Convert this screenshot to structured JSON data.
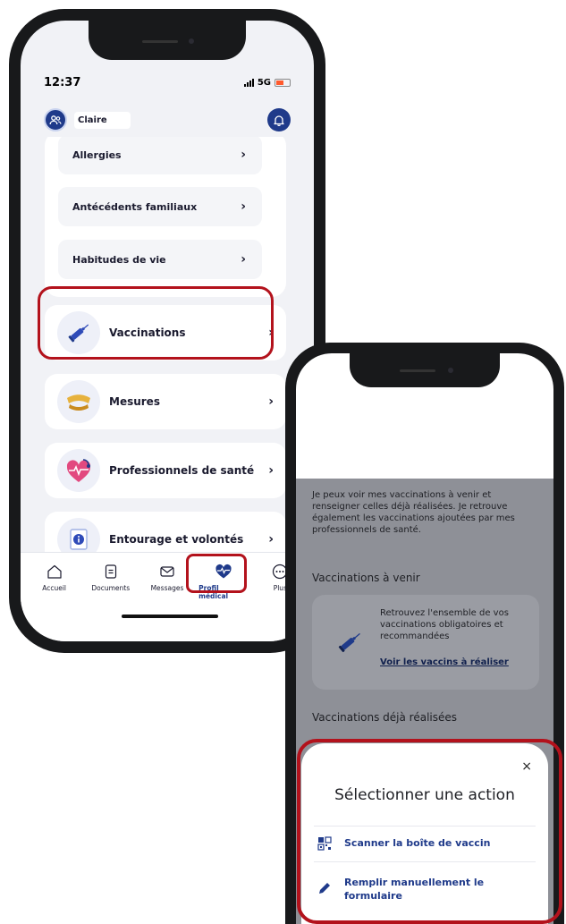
{
  "colors": {
    "primary": "#1f3a8a",
    "highlight": "#b3121c",
    "background": "#f1f2f6"
  },
  "status_bar": {
    "time": "12:37",
    "network": "5G"
  },
  "header": {
    "user_name": "Claire",
    "user_icon": "people-icon",
    "bell_icon": "bell-icon"
  },
  "sub_items": [
    {
      "label": "Allergies"
    },
    {
      "label": "Antécédents familiaux"
    },
    {
      "label": "Habitudes de vie"
    }
  ],
  "cards": [
    {
      "label": "Vaccinations",
      "icon": "syringe-icon"
    },
    {
      "label": "Mesures",
      "icon": "measuring-tape-icon"
    },
    {
      "label": "Professionnels de santé",
      "icon": "stethoscope-heart-icon"
    },
    {
      "label": "Entourage et volontés",
      "icon": "document-info-icon"
    }
  ],
  "tab_bar": {
    "tabs": [
      {
        "label": "Accueil",
        "icon": "home-icon"
      },
      {
        "label": "Documents",
        "icon": "document-icon"
      },
      {
        "label": "Messages",
        "icon": "mail-icon"
      },
      {
        "label": "Profil médical",
        "icon": "heart-pulse-icon",
        "active": true
      },
      {
        "label": "Plus",
        "icon": "more-icon"
      }
    ]
  },
  "vaccinations_screen": {
    "intro": "Je peux voir mes vaccinations à venir et renseigner celles déjà réalisées. Je retrouve également les vaccinations ajoutées par mes professionnels de santé.",
    "upcoming_heading": "Vaccinations à venir",
    "upcoming_card_text": "Retrouvez l'ensemble de vos vaccinations obligatoires et recommandées",
    "upcoming_card_link": "Voir les vaccins à réaliser",
    "done_heading": "Vaccinations déjà réalisées"
  },
  "action_sheet": {
    "close_label": "×",
    "title": "Sélectionner une action",
    "actions": [
      {
        "label": "Scanner la boîte de vaccin",
        "icon": "barcode-scan-icon"
      },
      {
        "label": "Remplir manuellement le formulaire",
        "icon": "pencil-icon"
      }
    ]
  }
}
